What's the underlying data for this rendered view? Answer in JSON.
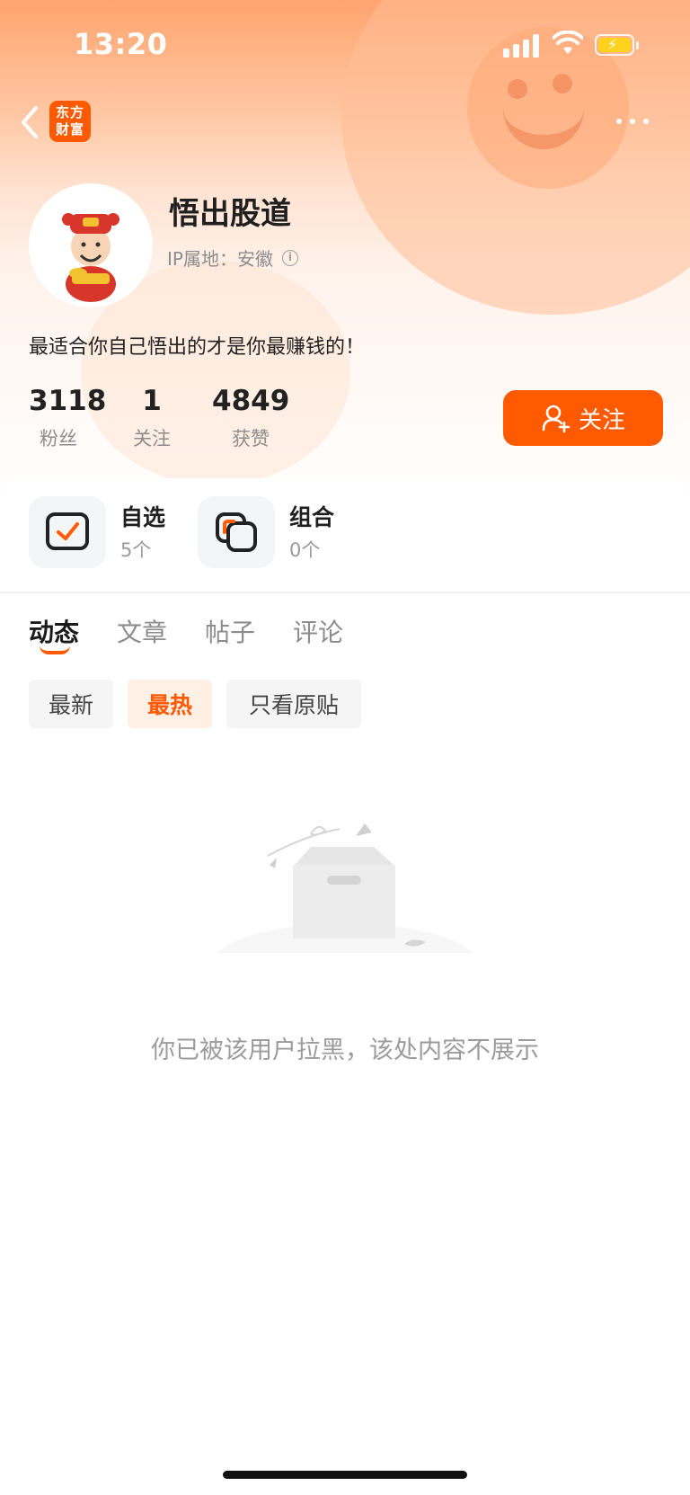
{
  "status_bar": {
    "time": "13:20"
  },
  "nav": {
    "logo_text_line1": "东方",
    "logo_text_line2": "财富"
  },
  "profile": {
    "name": "悟出股道",
    "ip_location": "IP属地：安徽",
    "bio": "最适合你自己悟出的才是你最赚钱的！",
    "stats": [
      {
        "value": "3118",
        "label": "粉丝"
      },
      {
        "value": "1",
        "label": "关注"
      },
      {
        "value": "4849",
        "label": "获赞"
      }
    ],
    "follow_label": "关注"
  },
  "shortcuts": [
    {
      "title": "自选",
      "count": "5个",
      "icon": "watchlist-check-icon"
    },
    {
      "title": "组合",
      "count": "0个",
      "icon": "portfolio-icon"
    }
  ],
  "tabs": [
    {
      "label": "动态",
      "active": true
    },
    {
      "label": "文章",
      "active": false
    },
    {
      "label": "帖子",
      "active": false
    },
    {
      "label": "评论",
      "active": false
    }
  ],
  "filters": [
    {
      "label": "最新",
      "active": false
    },
    {
      "label": "最热",
      "active": true
    },
    {
      "label": "只看原贴",
      "active": false
    }
  ],
  "empty_state": {
    "message": "你已被该用户拉黑，该处内容不展示"
  },
  "colors": {
    "accent": "#ff5a00",
    "header_gradient_top": "#ffa46f"
  }
}
